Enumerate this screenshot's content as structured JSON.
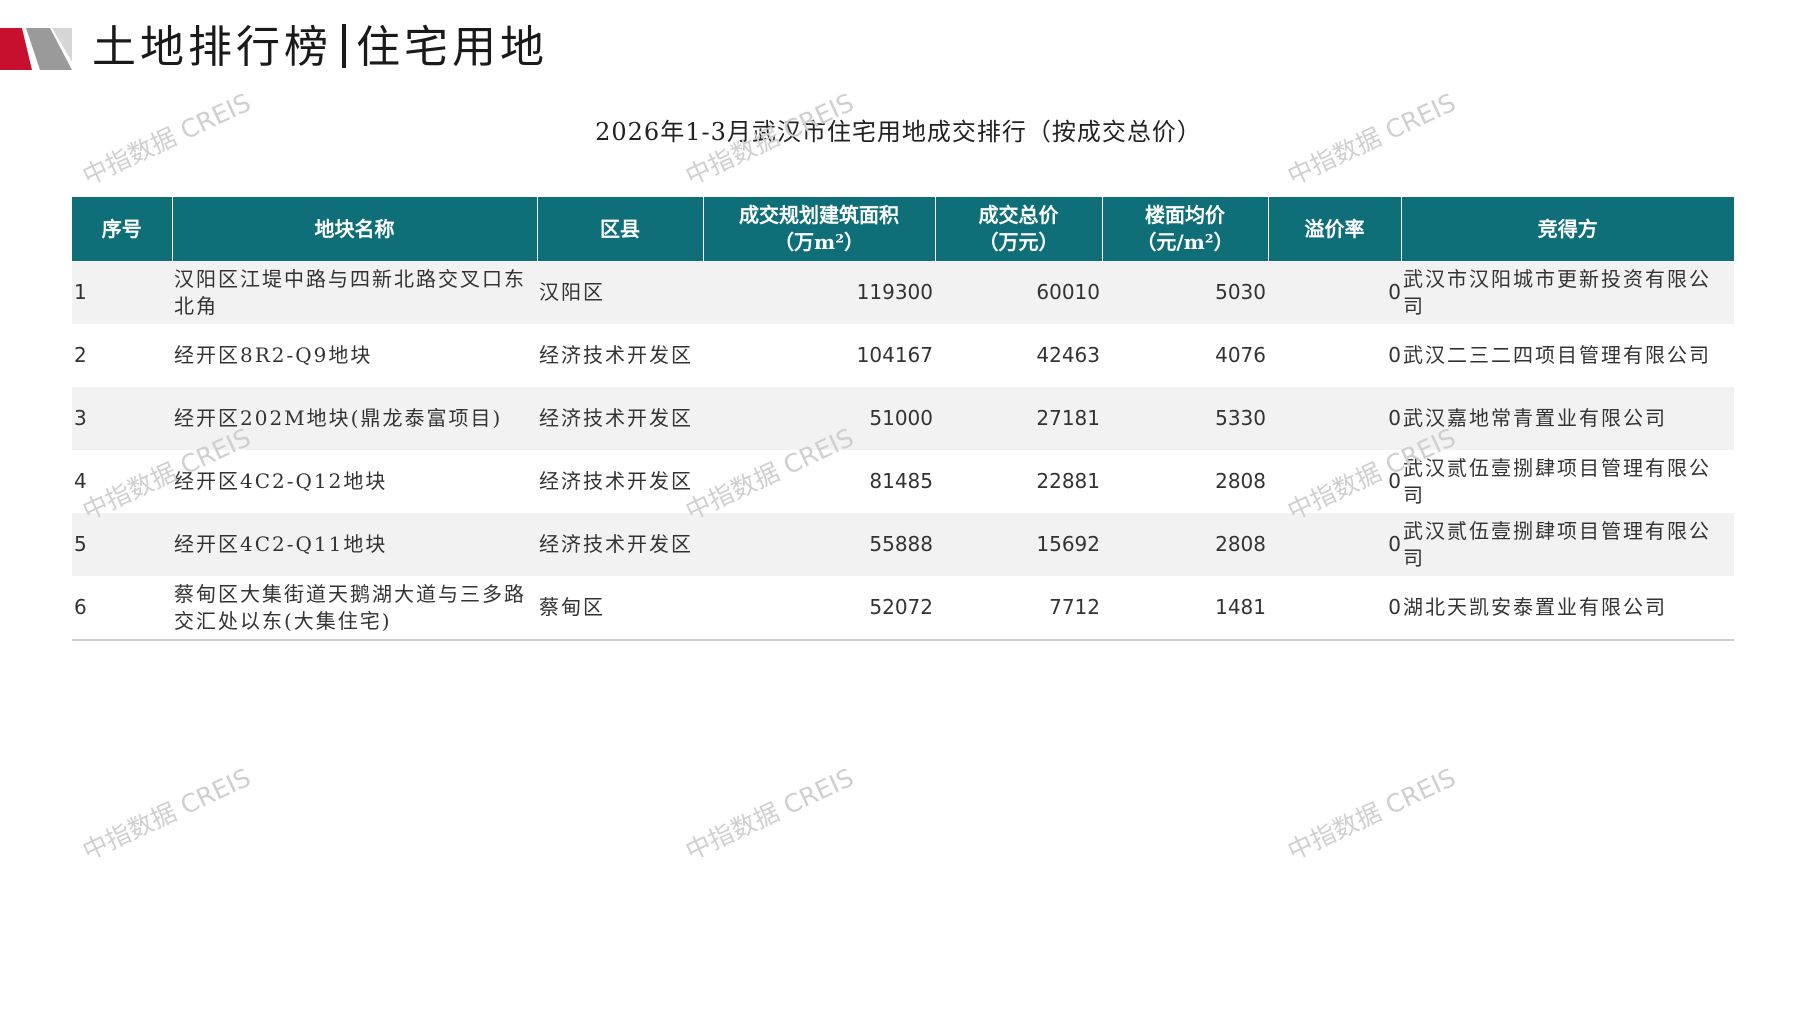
{
  "header": {
    "title_main": "土地排行榜",
    "title_sub": "住宅用地",
    "brand_colors": {
      "red": "#c8102e",
      "gray": "#8c8c8c",
      "teal": "#0f6f78"
    }
  },
  "caption": "2026年1-3月武汉市住宅用地成交排行（按成交总价）",
  "watermark_text": "中指数据 CREIS",
  "table": {
    "columns": [
      {
        "line1": "序号",
        "line2": ""
      },
      {
        "line1": "地块名称",
        "line2": ""
      },
      {
        "line1": "区县",
        "line2": ""
      },
      {
        "line1": "成交规划建筑面积",
        "line2": "（万m²）"
      },
      {
        "line1": "成交总价",
        "line2": "（万元）"
      },
      {
        "line1": "楼面均价",
        "line2": "（元/m²）"
      },
      {
        "line1": "溢价率",
        "line2": ""
      },
      {
        "line1": "竞得方",
        "line2": ""
      }
    ],
    "rows": [
      {
        "rank": "1",
        "name": "汉阳区江堤中路与四新北路交叉口东北角",
        "district": "汉阳区",
        "area": "119300",
        "total": "60010",
        "unit_price": "5030",
        "premium": "0",
        "winner": "武汉市汉阳城市更新投资有限公司"
      },
      {
        "rank": "2",
        "name": "经开区8R2-Q9地块",
        "district": "经济技术开发区",
        "area": "104167",
        "total": "42463",
        "unit_price": "4076",
        "premium": "0",
        "winner": "武汉二三二四项目管理有限公司"
      },
      {
        "rank": "3",
        "name": "经开区202M地块(鼎龙泰富项目)",
        "district": "经济技术开发区",
        "area": "51000",
        "total": "27181",
        "unit_price": "5330",
        "premium": "0",
        "winner": "武汉嘉地常青置业有限公司"
      },
      {
        "rank": "4",
        "name": "经开区4C2-Q12地块",
        "district": "经济技术开发区",
        "area": "81485",
        "total": "22881",
        "unit_price": "2808",
        "premium": "0",
        "winner": "武汉贰伍壹捌肆项目管理有限公司"
      },
      {
        "rank": "5",
        "name": "经开区4C2-Q11地块",
        "district": "经济技术开发区",
        "area": "55888",
        "total": "15692",
        "unit_price": "2808",
        "premium": "0",
        "winner": "武汉贰伍壹捌肆项目管理有限公司"
      },
      {
        "rank": "6",
        "name": "蔡甸区大集街道天鹅湖大道与三多路交汇处以东(大集住宅)",
        "district": "蔡甸区",
        "area": "52072",
        "total": "7712",
        "unit_price": "1481",
        "premium": "0",
        "winner": "湖北天凯安泰置业有限公司"
      }
    ]
  }
}
